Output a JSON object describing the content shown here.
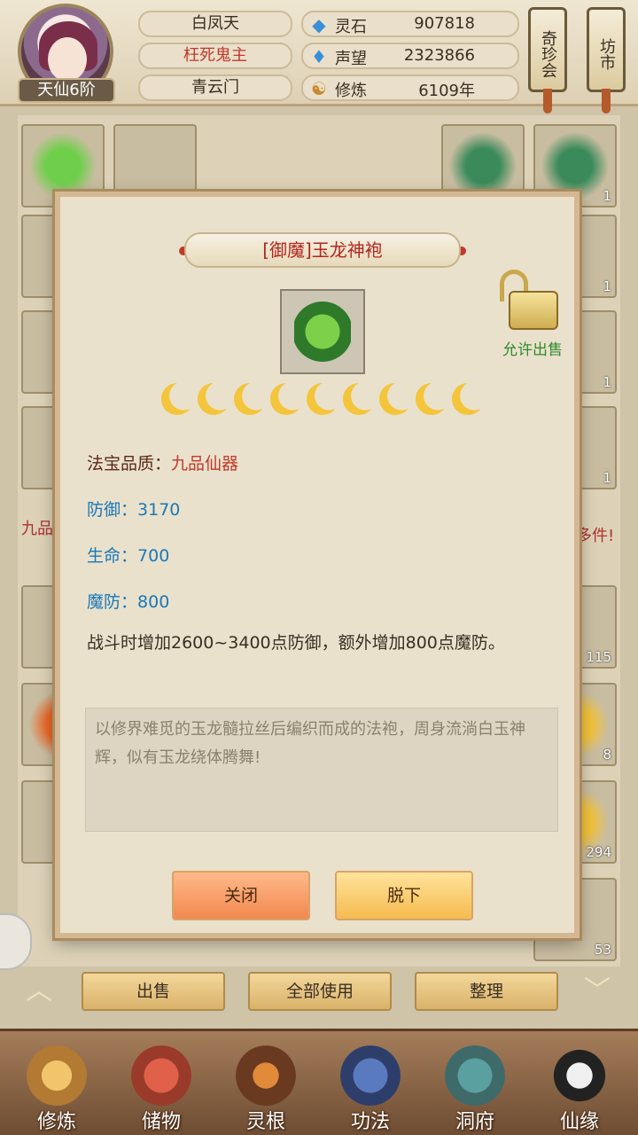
{
  "player": {
    "rank": "天仙6阶",
    "names": [
      "白凤天",
      "枉死鬼主",
      "青云门"
    ]
  },
  "stats": [
    {
      "icon": "spirit-stone-icon",
      "label": "灵石",
      "value": "907818"
    },
    {
      "icon": "reputation-icon",
      "label": "声望",
      "value": "2323866"
    },
    {
      "icon": "cultivation-icon",
      "label": "修炼",
      "value": "6109年"
    }
  ],
  "header_buttons": [
    "奇珍会",
    "坊市"
  ],
  "background": {
    "counts": [
      "1",
      "1",
      "1",
      "1",
      "1",
      "1",
      "1",
      "115",
      "8",
      "294",
      "53"
    ],
    "left_tag": "九品",
    "right_tag": "多件!"
  },
  "modal": {
    "title": "[御魔]玉龙神袍",
    "lock_label": "允许出售",
    "star_count": 9,
    "quality_label": "法宝品质：",
    "quality_value": "九品仙器",
    "attributes": [
      {
        "label": "防御：",
        "value": "3170"
      },
      {
        "label": "生命：",
        "value": "700"
      },
      {
        "label": "魔防：",
        "value": "800"
      }
    ],
    "effect": "战斗时增加2600~3400点防御，额外增加800点魔防。",
    "description": "以修界难觅的玉龙髓拉丝后编织而成的法袍，周身流淌白玉神辉，似有玉龙绕体腾舞!",
    "close_label": "关闭",
    "remove_label": "脱下"
  },
  "actions": [
    "出售",
    "全部使用",
    "整理"
  ],
  "nav": [
    "修炼",
    "储物",
    "灵根",
    "功法",
    "洞府",
    "仙缘"
  ],
  "colors": {
    "title_red": "#b3261e",
    "attr_blue": "#1a78b8",
    "lock_green": "#2e8b2e"
  }
}
